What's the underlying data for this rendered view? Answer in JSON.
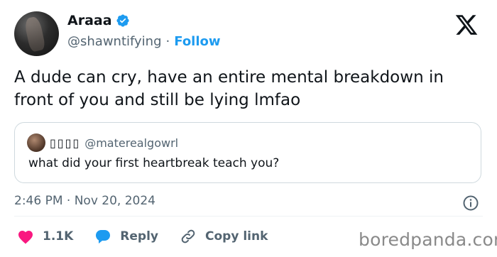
{
  "author": {
    "name": "Araaa",
    "handle": "@shawntifying",
    "separator": "·",
    "follow_label": "Follow"
  },
  "tweet": {
    "text": "A dude can cry, have an entire mental breakdown in front of you and still be lying lmfao"
  },
  "quote": {
    "display_name": "▯▯▯▯",
    "handle": "@materealgowrl",
    "text": "what did your first heartbreak teach you?"
  },
  "timestamp": "2:46 PM · Nov 20, 2024",
  "actions": {
    "likes": "1.1K",
    "reply_label": "Reply",
    "copy_label": "Copy link"
  },
  "watermark": "boredpanda.com",
  "colors": {
    "accent": "#1d9bf0",
    "like": "#f91880",
    "muted_text": "#536471",
    "text": "#0f1419"
  },
  "icons": [
    "verified-badge-icon",
    "x-logo-icon",
    "info-icon",
    "heart-icon",
    "reply-icon",
    "link-icon"
  ]
}
